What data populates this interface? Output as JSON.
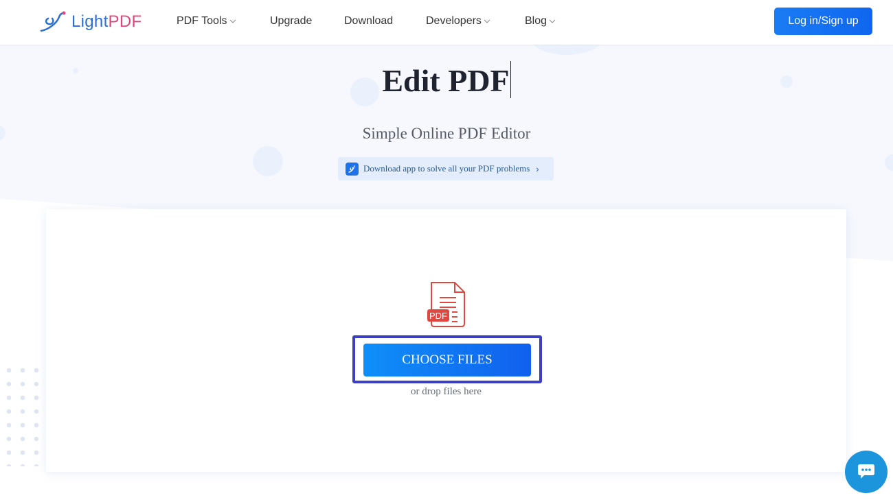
{
  "header": {
    "logo": {
      "part1": "Light",
      "part2": "PDF"
    },
    "nav": [
      {
        "label": "PDF Tools",
        "has_dropdown": true
      },
      {
        "label": "Upgrade",
        "has_dropdown": false
      },
      {
        "label": "Download",
        "has_dropdown": false
      },
      {
        "label": "Developers",
        "has_dropdown": true
      },
      {
        "label": "Blog",
        "has_dropdown": true
      }
    ],
    "login_label": "Log in/Sign up"
  },
  "hero": {
    "title": "Edit PDF",
    "subtitle": "Simple Online PDF Editor",
    "promo": {
      "text": "Download app to solve all your PDF problems",
      "arrow": "›"
    }
  },
  "upload": {
    "file_icon_label": "PDF",
    "choose_label": "CHOOSE FILES",
    "drop_text": "or drop files here"
  },
  "colors": {
    "primary": "#1a7cf5",
    "logo_blue": "#2a6fd1",
    "logo_pink": "#e0457b",
    "pdf_red": "#e0473f",
    "highlight_outline": "#3b3fc4",
    "chat": "#1d95dc"
  }
}
